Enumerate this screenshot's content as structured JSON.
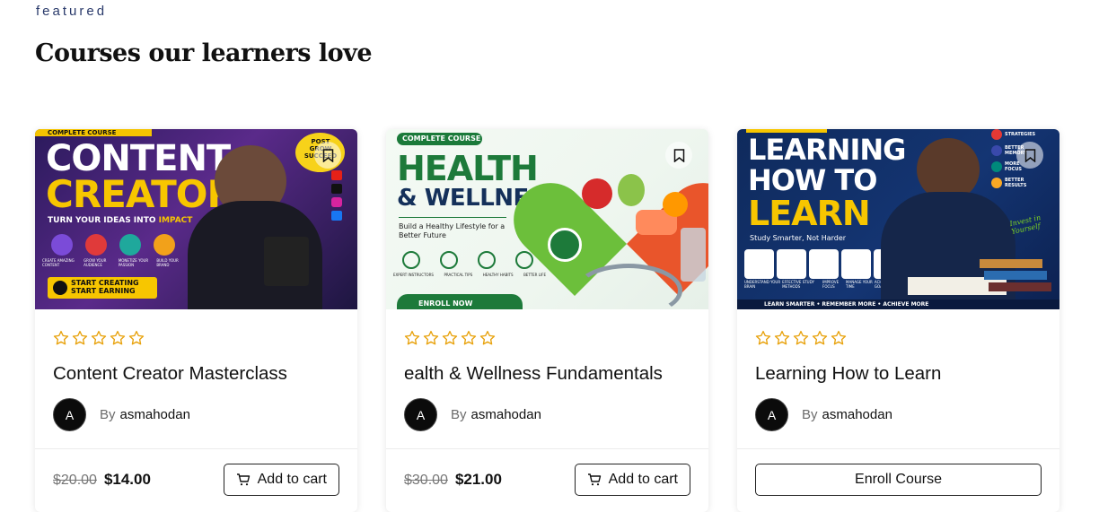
{
  "section": {
    "eyebrow": "featured",
    "heading": "Courses our learners love"
  },
  "colors": {
    "star": "#e8a20c",
    "avatar_bg": "#0b0b0b"
  },
  "courses": [
    {
      "title": "Content Creator Masterclass",
      "rating_stars": 5,
      "avatar_letter": "A",
      "by_label": "By",
      "author": "asmahodan",
      "old_price": "$20.00",
      "new_price": "$14.00",
      "action_label": "Add to cart",
      "thumb": {
        "line1": "CONTENT",
        "line2": "CREATOR",
        "tagline_a": "TURN YOUR IDEAS INTO",
        "tagline_b": "IMPACT",
        "cta": "START CREATING START EARNING",
        "badge_top": "COMPLETE COURSE",
        "bubble": "POST GROW SUCCEED",
        "features": [
          "CREATE AMAZING CONTENT",
          "GROW YOUR AUDIENCE",
          "MONETIZE YOUR PASSION",
          "BUILD YOUR BRAND"
        ]
      }
    },
    {
      "title": "ealth & Wellness Fundamentals",
      "rating_stars": 5,
      "avatar_letter": "A",
      "by_label": "By",
      "author": "asmahodan",
      "old_price": "$30.00",
      "new_price": "$21.00",
      "action_label": "Add to cart",
      "thumb": {
        "badge_top": "COMPLETE COURSE",
        "line1": "HEALTH",
        "line2": "& WELLNESS",
        "tagline": "Build a Healthy Lifestyle for a Better Future",
        "features": [
          "EXPERT INSTRUCTORS",
          "PRACTICAL TIPS",
          "HEALTHY HABITS",
          "BETTER LIFE"
        ],
        "cta": "ENROLL NOW"
      }
    },
    {
      "title": "Learning How to Learn",
      "rating_stars": 5,
      "avatar_letter": "A",
      "by_label": "By",
      "author": "asmahodan",
      "action_label": "Enroll Course",
      "thumb": {
        "line1": "LEARNING",
        "line2": "HOW TO",
        "line3": "LEARN",
        "tagline": "Study Smarter, Not Harder",
        "side": [
          "STRATEGIES",
          "BETTER MEMORY",
          "MORE FOCUS",
          "BETTER RESULTS"
        ],
        "script": "Invest in Yourself",
        "features": [
          "UNDERSTAND YOUR BRAIN",
          "EFFECTIVE STUDY METHODS",
          "IMPROVE FOCUS",
          "MANAGE YOUR TIME",
          "ACHIEVE YOUR GOALS"
        ],
        "footer": "LEARN SMARTER • REMEMBER MORE • ACHIEVE MORE"
      }
    }
  ]
}
